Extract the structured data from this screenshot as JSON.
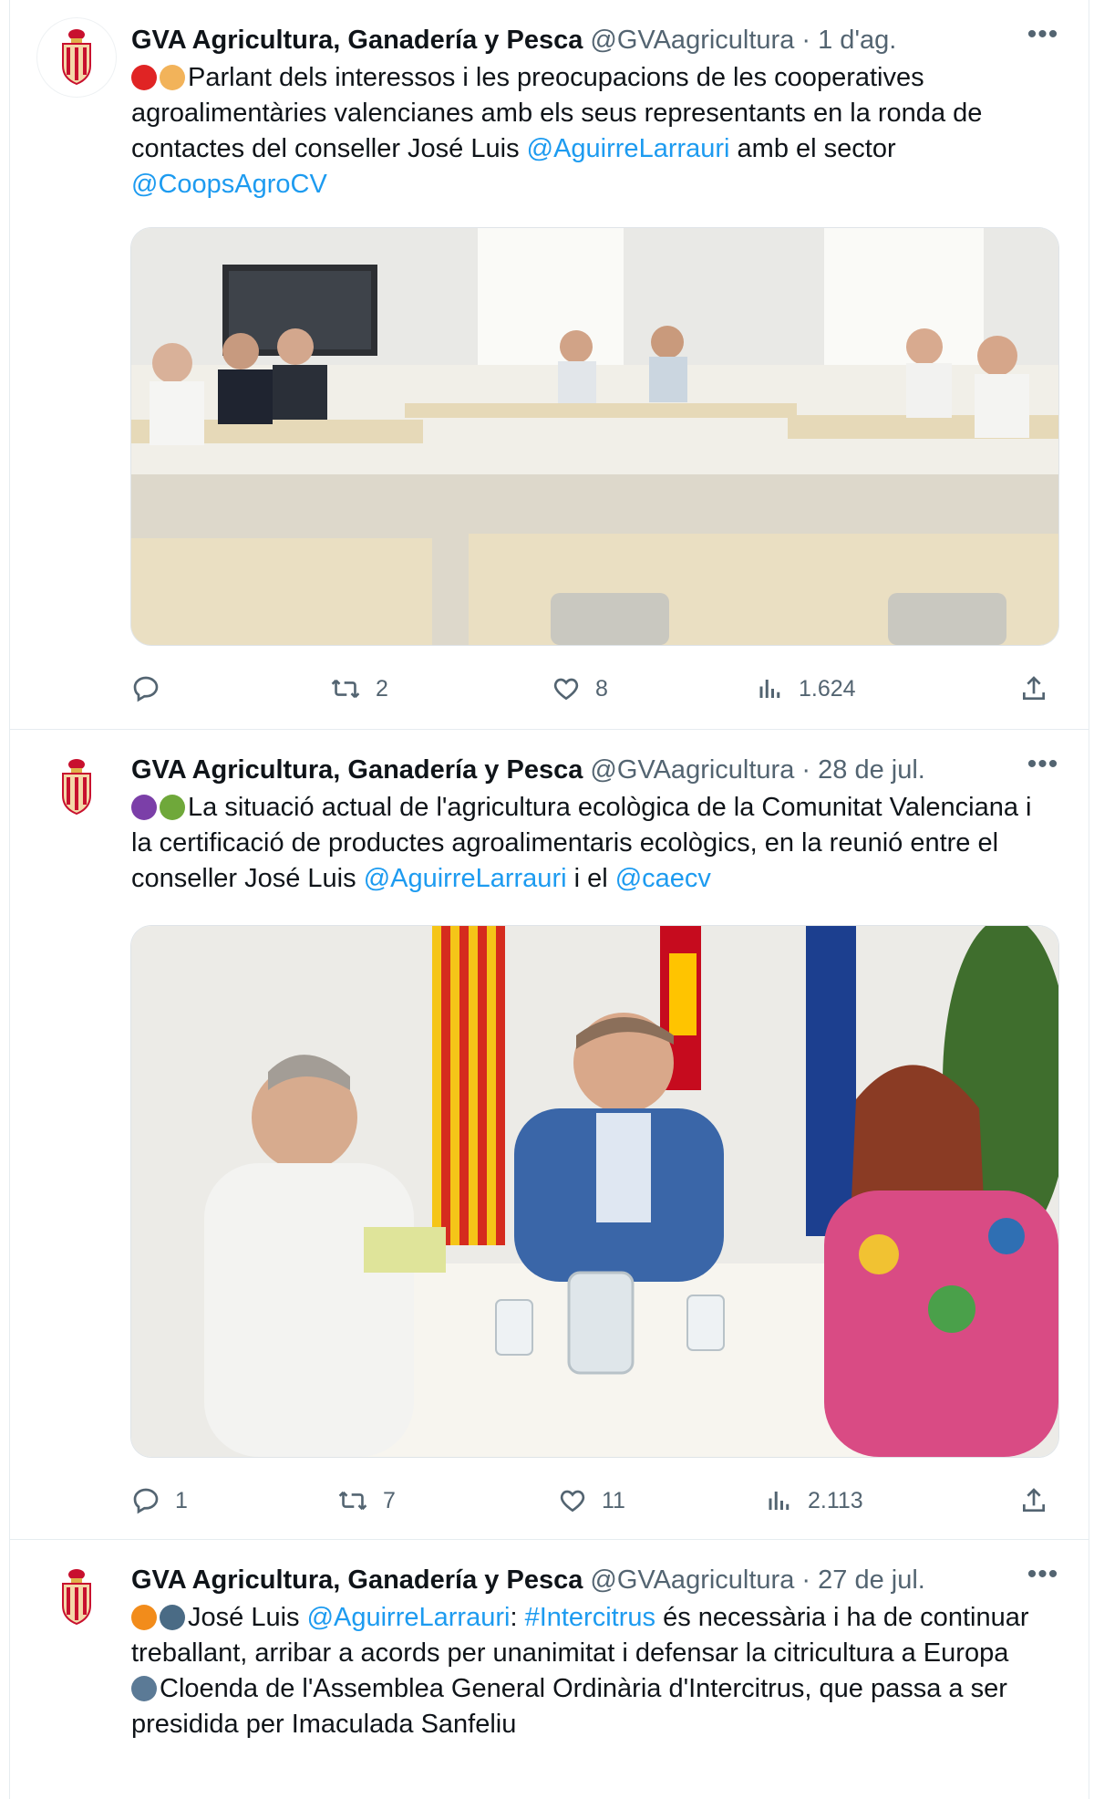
{
  "colors": {
    "link": "#1d9bf0",
    "muted": "#536471",
    "text": "#0f1419",
    "border": "#e6ecf0"
  },
  "tweets": [
    {
      "name": "GVA Agricultura, Ganadería y Pesca",
      "handle": "@GVAagricultura",
      "sep": " · ",
      "date": "1 d'ag.",
      "more": "•••",
      "text_a": "Parlant dels interessos i les preocupacions de les cooperatives agroalimentàries valencianes amb els seus representants en la ronda de contactes del conseller José Luis ",
      "mention_1": "@AguirreLarrauri",
      "text_b": " amb el sector ",
      "mention_2": "@CoopsAgroCV",
      "emojis": [
        "tomato",
        "farmer"
      ],
      "image": "meeting room photo",
      "stats": {
        "replies": "",
        "retweets": "2",
        "likes": "8",
        "views": "1.624"
      }
    },
    {
      "name": "GVA Agricultura, Ganadería y Pesca",
      "handle": "@GVAagricultura",
      "sep": " · ",
      "date": "28 de jul.",
      "more": "•••",
      "text_a": "La situació actual de l'agricultura ecològica de la Comunitat Valenciana i la certificació de productes agroalimentaris ecològics, en la reunió entre el conseller José Luis ",
      "mention_1": "@AguirreLarrauri",
      "text_b": " i el ",
      "mention_2": "@caecv",
      "emojis": [
        "grapes",
        "herb"
      ],
      "image": "meeting with flags photo",
      "stats": {
        "replies": "1",
        "retweets": "7",
        "likes": "11",
        "views": "2.113"
      }
    },
    {
      "name": "GVA Agricultura, Ganadería y Pesca",
      "handle": "@GVAagricultura",
      "sep": " · ",
      "date": "27 de jul.",
      "more": "•••",
      "text_a": "José Luis ",
      "mention_1": "@AguirreLarrauri",
      "text_colon": ": ",
      "hashtag": "#Intercitrus",
      "text_b": " és necessària i ha de continuar treballant, arribar a acords per unanimitat i defensar la citricultura a Europa",
      "text_c": "Cloenda de l'Assemblea General Ordinària d'Intercitrus, que passa a ser presidida per Imaculada Sanfeliu",
      "emojis": [
        "orange",
        "speaking-head",
        "busts"
      ]
    }
  ]
}
